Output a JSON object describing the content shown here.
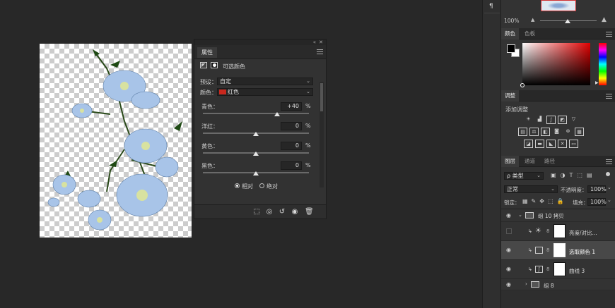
{
  "properties": {
    "tab": "属性",
    "header_title": "可选颜色",
    "preset_label": "预设：",
    "preset_value": "自定",
    "colors_label": "颜色：",
    "colors_value": "红色",
    "colors_swatch": "#c8281e",
    "sliders": [
      {
        "label": "青色：",
        "value": "+40",
        "unit": "%",
        "level": 0.7
      },
      {
        "label": "洋红：",
        "value": "0",
        "unit": "%",
        "level": 0.5
      },
      {
        "label": "黄色：",
        "value": "0",
        "unit": "%",
        "level": 0.5
      },
      {
        "label": "黑色：",
        "value": "0",
        "unit": "%",
        "level": 0.5
      }
    ],
    "method_relative": "相对",
    "method_absolute": "绝对",
    "method_selected": "relative"
  },
  "dock": {
    "nav_zoom": "100%",
    "color_tabs": [
      "颜色",
      "色板"
    ],
    "adjust_tab": "调整",
    "adjust_hint": "添加调整",
    "layer_tabs": [
      "图层",
      "通道",
      "路径"
    ],
    "filter_label": "ρ 类型",
    "blend_mode": "正常",
    "opacity_label": "不透明度：",
    "opacity_value": "100%",
    "lock_label": "锁定：",
    "fill_label": "填充：",
    "fill_value": "100%",
    "layers": [
      {
        "name": "组 10 拷贝",
        "kind": "group",
        "visible": true
      },
      {
        "name": "亮度/对比...",
        "kind": "adjustment",
        "visible": false
      },
      {
        "name": "选取颜色 1",
        "kind": "adjustment",
        "visible": true,
        "selected": true
      },
      {
        "name": "曲线 3",
        "kind": "adjustment",
        "visible": true
      },
      {
        "name": "组 8",
        "kind": "group",
        "visible": true
      }
    ]
  }
}
